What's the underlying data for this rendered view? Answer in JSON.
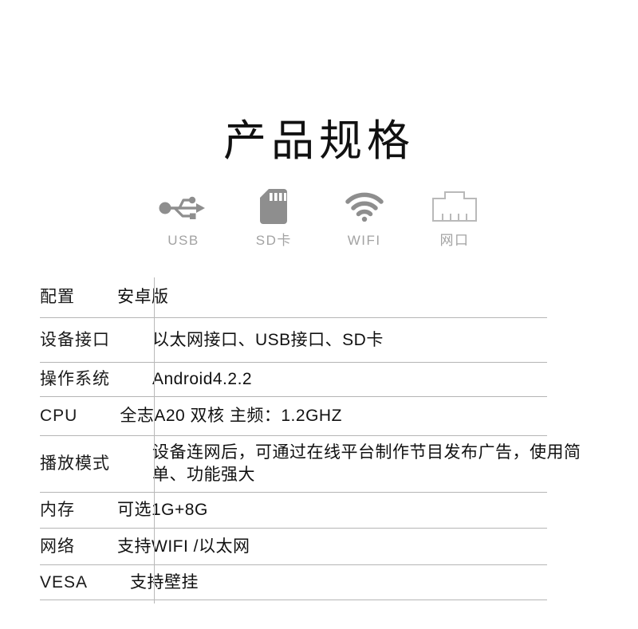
{
  "page": {
    "title": "产品规格",
    "background_color": "#ffffff",
    "text_color": "#111111",
    "muted_color": "#a3a3a3",
    "rule_color": "#b5b5b5",
    "icon_color": "#8e8e8e"
  },
  "features": [
    {
      "icon": "usb-icon",
      "label": "USB"
    },
    {
      "icon": "sd-card-icon",
      "label": "SD卡"
    },
    {
      "icon": "wifi-icon",
      "label": "WIFI"
    },
    {
      "icon": "ethernet-port-icon",
      "label": "网口"
    }
  ],
  "spec_table": {
    "rows": [
      {
        "key": "配置",
        "value": "安卓版"
      },
      {
        "key": "设备接口",
        "value": "以太网接口、USB接口、SD卡"
      },
      {
        "key": "操作系统",
        "value": "Android4.2.2"
      },
      {
        "key": "CPU",
        "value": "全志A20 双核 主频：1.2GHZ"
      },
      {
        "key": "播放模式",
        "value": "设备连网后，可通过在线平台制作节目发布广告，使用简单、功能强大"
      },
      {
        "key": "内存",
        "value": "可选1G+8G"
      },
      {
        "key": "网络",
        "value": "支持WIFI /以太网"
      },
      {
        "key": "VESA",
        "value": "支持壁挂"
      }
    ]
  }
}
